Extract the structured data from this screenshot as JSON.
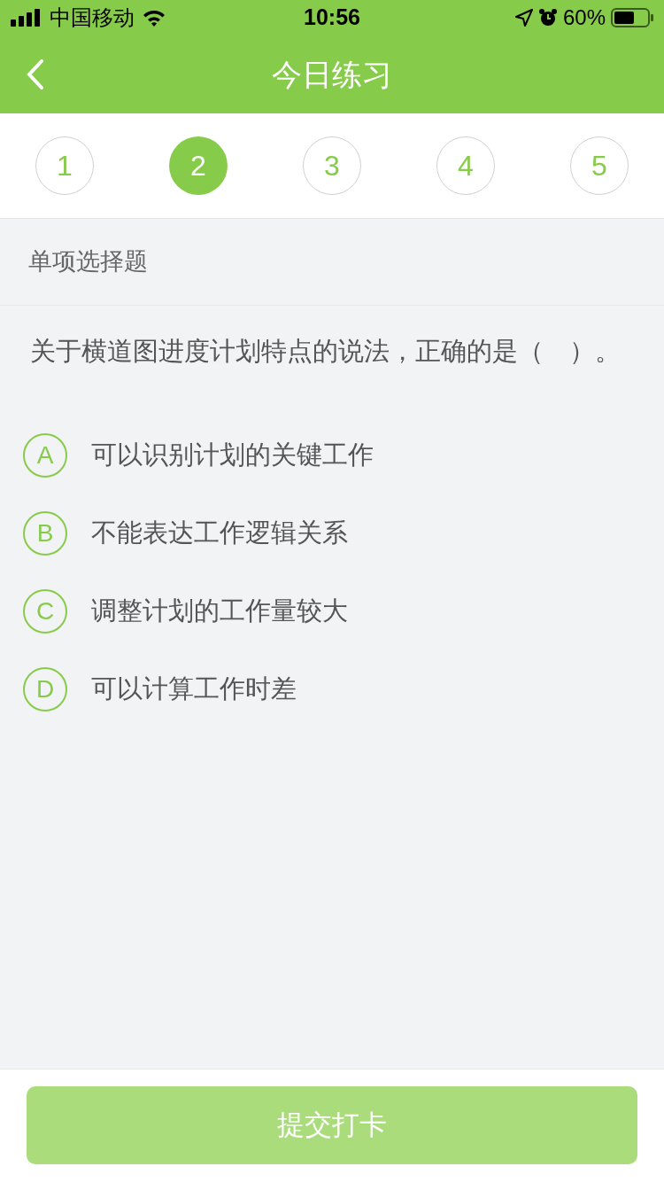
{
  "status_bar": {
    "carrier": "中国移动",
    "time": "10:56",
    "battery": "60%"
  },
  "nav": {
    "title": "今日练习"
  },
  "steps": [
    {
      "label": "1",
      "selected": false
    },
    {
      "label": "2",
      "selected": true
    },
    {
      "label": "3",
      "selected": false
    },
    {
      "label": "4",
      "selected": false
    },
    {
      "label": "5",
      "selected": false
    }
  ],
  "question": {
    "type": "单项选择题",
    "text": "关于横道图进度计划特点的说法，正确的是（　）。",
    "options": [
      {
        "letter": "A",
        "text": "可以识别计划的关键工作",
        "selected": false
      },
      {
        "letter": "B",
        "text": "不能表达工作逻辑关系",
        "selected": false
      },
      {
        "letter": "C",
        "text": "调整计划的工作量较大",
        "selected": false
      },
      {
        "letter": "D",
        "text": "可以计算工作时差",
        "selected": false
      }
    ]
  },
  "submit": {
    "label": "提交打卡",
    "disabled": true
  }
}
